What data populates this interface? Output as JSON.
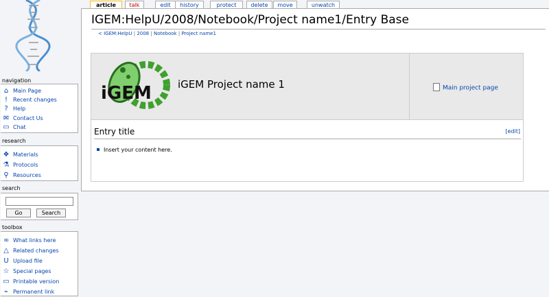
{
  "tabs": [
    {
      "label": "article"
    },
    {
      "label": "talk"
    },
    {
      "label": "edit"
    },
    {
      "label": "history"
    },
    {
      "label": "protect"
    },
    {
      "label": "delete"
    },
    {
      "label": "move"
    },
    {
      "label": "unwatch"
    }
  ],
  "page": {
    "title": "IGEM:HelpU/2008/Notebook/Project name1/Entry Base",
    "breadcrumbs": [
      "< IGEM:HelpU",
      "2008",
      "Notebook",
      "Project name1"
    ],
    "banner": {
      "project_name": "iGEM Project name 1",
      "main_link": "Main project page"
    },
    "entry": {
      "title": "Entry title",
      "edit": "[edit]",
      "text": "Insert your content here."
    }
  },
  "sidebar": {
    "navigation_title": "navigation",
    "navigation": [
      {
        "label": "Main Page",
        "icon": "⌂"
      },
      {
        "label": "Recent changes",
        "icon": "!"
      },
      {
        "label": "Help",
        "icon": "?"
      },
      {
        "label": "Contact Us",
        "icon": "✉"
      },
      {
        "label": "Chat",
        "icon": "▭"
      }
    ],
    "research_title": "research",
    "research": [
      {
        "label": "Materials",
        "icon": "❖"
      },
      {
        "label": "Protocols",
        "icon": "⚗"
      },
      {
        "label": "Resources",
        "icon": "⚲"
      }
    ],
    "search_title": "search",
    "search": {
      "value": "",
      "go": "Go",
      "search": "Search"
    },
    "toolbox_title": "toolbox",
    "toolbox": [
      {
        "label": "What links here",
        "icon": "∞"
      },
      {
        "label": "Related changes",
        "icon": "△"
      },
      {
        "label": "Upload file",
        "icon": "U"
      },
      {
        "label": "Special pages",
        "icon": "☆"
      },
      {
        "label": "Printable version",
        "icon": "▭"
      },
      {
        "label": "Permanent link",
        "icon": "⌁"
      }
    ]
  },
  "colors": {
    "link": "#0645ad",
    "selected_tab": "#fabd23",
    "new_link": "#ba0000"
  }
}
